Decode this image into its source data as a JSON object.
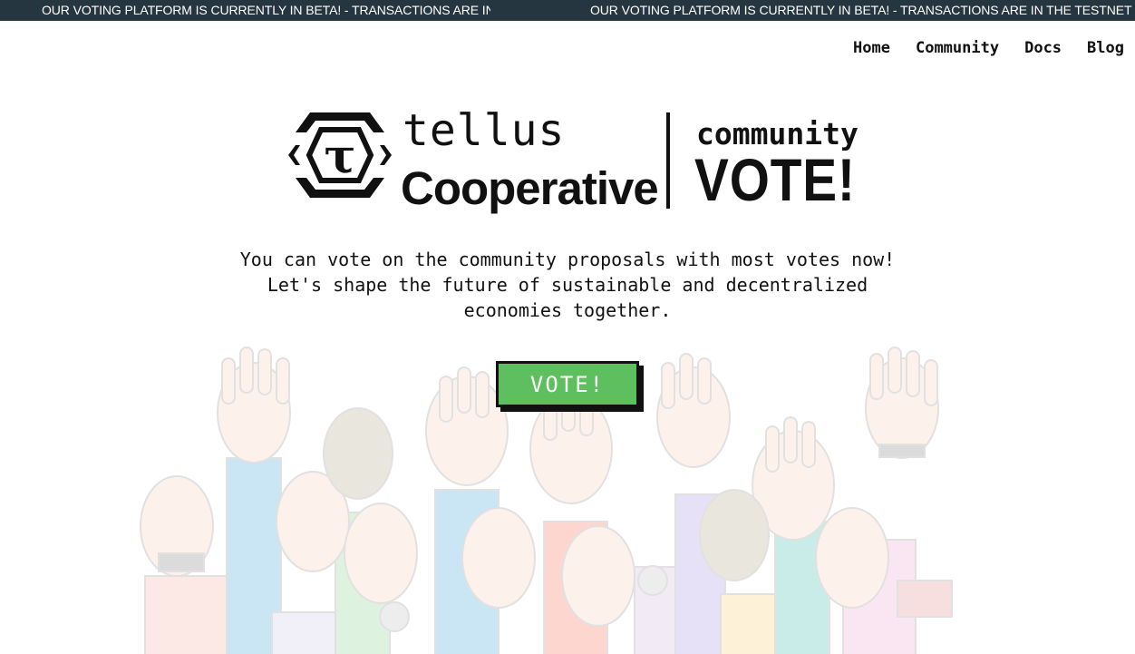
{
  "ticker": {
    "message_1": "OUR VOTING PLATFORM IS CURRENTLY IN BETA! - TRANSACTIONS ARE IN THE",
    "message_2": "OUR VOTING PLATFORM IS CURRENTLY IN BETA! - TRANSACTIONS ARE IN THE TESTNET"
  },
  "nav": {
    "items": [
      "Home",
      "Community",
      "Docs",
      "Blog"
    ]
  },
  "logo": {
    "mark_letter": "τ",
    "brand_top": "tellus",
    "brand_bottom": "Cooperative",
    "tag_top": "community",
    "tag_bottom": "VOTE!"
  },
  "intro": {
    "line_1": "You can vote on the community proposals with most votes now!",
    "line_2": "Let's shape the future of sustainable and decentralized",
    "line_3": "economies together."
  },
  "cta": {
    "label": "VOTE!"
  },
  "colors": {
    "ticker_bg": "#263640",
    "button_green": "#5dbf5d",
    "text": "#111111"
  }
}
